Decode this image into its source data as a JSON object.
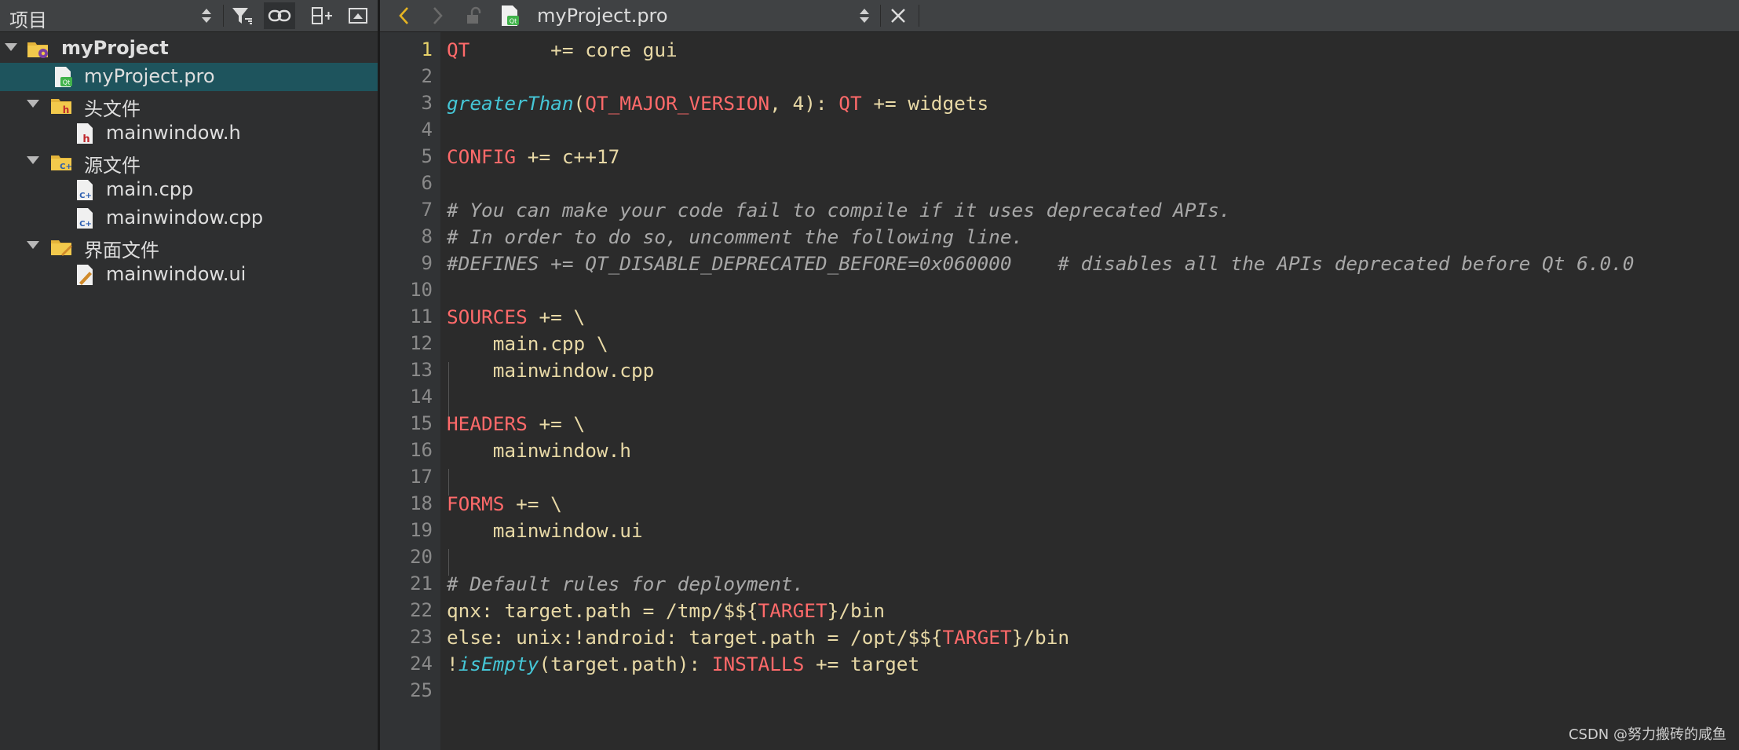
{
  "project_panel": {
    "title": "项目",
    "tree": [
      {
        "label": "myProject",
        "icon": "qt-project-folder-icon",
        "bold": true,
        "expanded": true,
        "depth": 0
      },
      {
        "label": "myProject.pro",
        "icon": "qt-pro-file-icon",
        "selected": true,
        "depth": 1
      },
      {
        "label": "头文件",
        "icon": "header-folder-icon",
        "expanded": true,
        "depth": 1
      },
      {
        "label": "mainwindow.h",
        "icon": "header-file-icon",
        "depth": 2
      },
      {
        "label": "源文件",
        "icon": "source-folder-icon",
        "expanded": true,
        "depth": 1
      },
      {
        "label": "main.cpp",
        "icon": "cpp-file-icon",
        "depth": 2
      },
      {
        "label": "mainwindow.cpp",
        "icon": "cpp-file-icon",
        "depth": 2
      },
      {
        "label": "界面文件",
        "icon": "forms-folder-icon",
        "expanded": true,
        "depth": 1
      },
      {
        "label": "mainwindow.ui",
        "icon": "ui-file-icon",
        "depth": 2
      }
    ]
  },
  "editor": {
    "file_name": "myProject.pro",
    "current_line": 1,
    "line_numbers": [
      "1",
      "2",
      "3",
      "4",
      "5",
      "6",
      "7",
      "8",
      "9",
      "10",
      "11",
      "12",
      "13",
      "14",
      "15",
      "16",
      "17",
      "18",
      "19",
      "20",
      "21",
      "22",
      "23",
      "24",
      "25"
    ],
    "lines": [
      "QT       += core gui",
      "",
      "greaterThan(QT_MAJOR_VERSION, 4): QT += widgets",
      "",
      "CONFIG += c++17",
      "",
      "# You can make your code fail to compile if it uses deprecated APIs.",
      "# In order to do so, uncomment the following line.",
      "#DEFINES += QT_DISABLE_DEPRECATED_BEFORE=0x060000    # disables all the APIs deprecated before Qt 6.0.0",
      "",
      "SOURCES += \\",
      "    main.cpp \\",
      "    mainwindow.cpp",
      "",
      "HEADERS += \\",
      "    mainwindow.h",
      "",
      "FORMS += \\",
      "    mainwindow.ui",
      "",
      "# Default rules for deployment.",
      "qnx: target.path = /tmp/$${TARGET}/bin",
      "else: unix:!android: target.path = /opt/$${TARGET}/bin",
      "!isEmpty(target.path): INSTALLS += target",
      ""
    ]
  },
  "watermark": "CSDN @努力搬砖的咸鱼",
  "colors": {
    "variable": "#ff6a6a",
    "function": "#45c6d6",
    "comment": "#a8a8a8",
    "value": "#e8d9a6",
    "selection": "#1e545d",
    "back_arrow": "#e6b422"
  }
}
